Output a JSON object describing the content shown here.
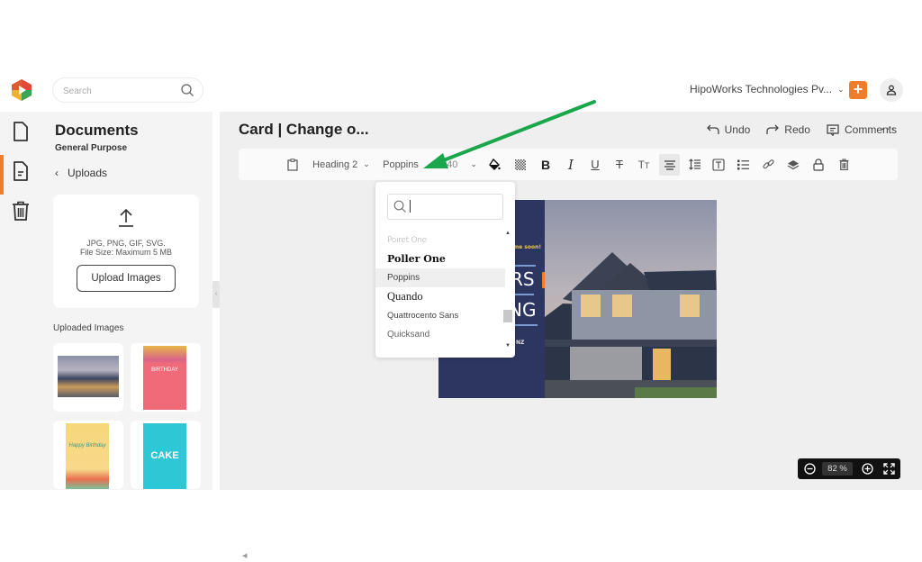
{
  "topbar": {
    "search_placeholder": "Search",
    "org_name": "HipoWorks Technologies Pv...",
    "add_label": "+"
  },
  "rail": {
    "items": [
      {
        "icon": "file-icon",
        "active": false
      },
      {
        "icon": "document-icon",
        "active": true
      },
      {
        "icon": "trash-icon",
        "active": false
      }
    ]
  },
  "panel": {
    "title": "Documents",
    "subtitle": "General Purpose",
    "back_label": "Uploads",
    "upload_formats": "JPG, PNG, GIF, SVG.",
    "upload_size": "File Size: Maximum 5 MB",
    "upload_button": "Upload Images",
    "uploaded_label": "Uploaded Images",
    "thumbnails": [
      {
        "name": "house-photo"
      },
      {
        "name": "birthday-card-pink",
        "text": "BIRTHDAY"
      },
      {
        "name": "happy-birthday-card",
        "text": "Happy Birthday"
      },
      {
        "name": "cake-card",
        "text": "CAKE"
      }
    ]
  },
  "editor": {
    "doc_title": "Card | Change o...",
    "undo": "Undo",
    "redo": "Redo",
    "comments": "Comments",
    "more": "···",
    "toolbar": {
      "text_style": "Heading 2",
      "font": "Poppins",
      "font_size": "40"
    },
    "card": {
      "tagline": "...me soon!",
      "line1": "RS",
      "line2": "NG",
      "footer": "NZ"
    }
  },
  "font_dropdown": {
    "search_value": "",
    "items": [
      "Poiret One",
      "Poller One",
      "Poppins",
      "Quando",
      "Quattrocento Sans",
      "Quicksand"
    ],
    "hovered": "Poppins"
  },
  "zoom": {
    "value": "82",
    "unit": "%"
  },
  "colors": {
    "accent": "#f07d2b",
    "card_navy": "#2d3561",
    "annotation_arrow": "#1aa64a"
  }
}
